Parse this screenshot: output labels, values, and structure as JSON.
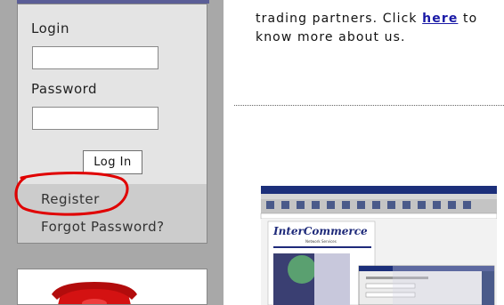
{
  "login": {
    "login_label": "Login",
    "password_label": "Password",
    "login_button": "Log In",
    "register_link": "Register",
    "forgot_link": "Forgot Password?"
  },
  "about": {
    "text_before": "trading partners. Click ",
    "link": "here",
    "text_after": " to",
    "line2": "know more about us."
  },
  "screenshot": {
    "brand": "InterCommerce",
    "brand_sub": "Network Services"
  },
  "colors": {
    "highlight": "#e00000",
    "link": "#1a1aa6",
    "panel": "#e4e4e4",
    "sidebar": "#a8a8a8"
  }
}
